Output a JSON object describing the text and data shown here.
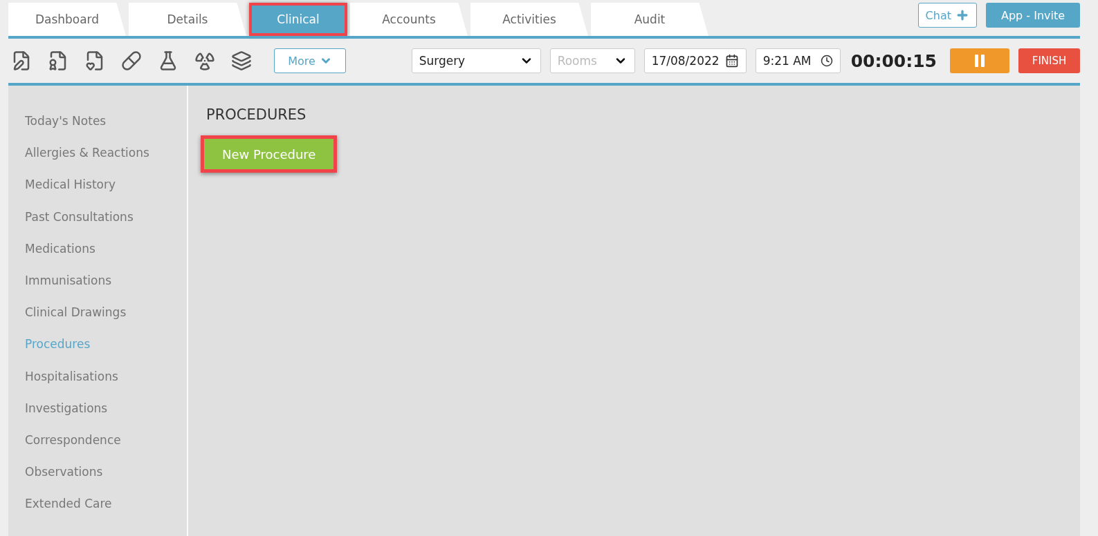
{
  "tabs": [
    {
      "label": "Dashboard",
      "selected": false,
      "highlighted": false
    },
    {
      "label": "Details",
      "selected": false,
      "highlighted": false
    },
    {
      "label": "Clinical",
      "selected": true,
      "highlighted": true
    },
    {
      "label": "Accounts",
      "selected": false,
      "highlighted": false
    },
    {
      "label": "Activities",
      "selected": false,
      "highlighted": false
    },
    {
      "label": "Audit",
      "selected": false,
      "highlighted": false
    }
  ],
  "header_buttons": [
    {
      "kind": "outline",
      "label": "Chat"
    },
    {
      "kind": "solid",
      "label": "App - Invite"
    }
  ],
  "toolbar": {
    "more_button": "More",
    "location": {
      "value": "Surgery"
    },
    "room": {
      "placeholder": "Rooms"
    },
    "date": {
      "value": "17/08/2022"
    },
    "time": {
      "value": "9:21 AM"
    },
    "timer": "00:00:15",
    "finish_button": "FINISH"
  },
  "sidebar": {
    "items": [
      {
        "label": "Today's Notes",
        "selected": false
      },
      {
        "label": "Allergies & Reactions",
        "selected": false
      },
      {
        "label": "Medical History",
        "selected": false
      },
      {
        "label": "Past Consultations",
        "selected": false
      },
      {
        "label": "Medications",
        "selected": false
      },
      {
        "label": "Immunisations",
        "selected": false
      },
      {
        "label": "Clinical Drawings",
        "selected": false
      },
      {
        "label": "Procedures",
        "selected": true
      },
      {
        "label": "Hospitalisations",
        "selected": false
      },
      {
        "label": "Investigations",
        "selected": false
      },
      {
        "label": "Correspondence",
        "selected": false
      },
      {
        "label": "Observations",
        "selected": false
      },
      {
        "label": "Extended Care",
        "selected": false
      }
    ]
  },
  "main": {
    "heading": "PROCEDURES",
    "new_button": {
      "label": "New Procedure",
      "highlighted": true
    }
  }
}
